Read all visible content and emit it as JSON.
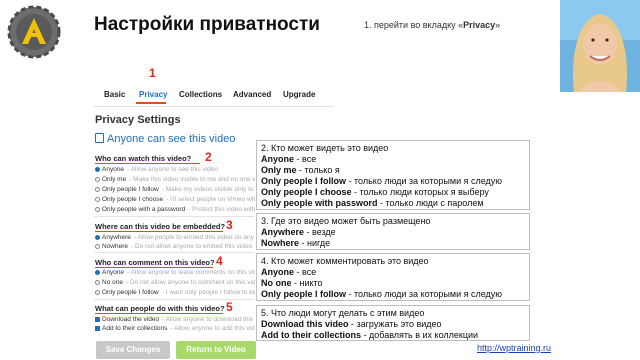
{
  "slide": {
    "title": "Настройки приватности",
    "step1_prefix": "1.  перейти во вкладку «",
    "step1_tab": "Privacy",
    "step1_suffix": "»",
    "link": "http://wptraining.ru"
  },
  "tabs": [
    {
      "label": "Basic",
      "active": false
    },
    {
      "label": "Privacy",
      "active": true
    },
    {
      "label": "Collections",
      "active": false
    },
    {
      "label": "Advanced",
      "active": false
    },
    {
      "label": "Upgrade",
      "active": false
    }
  ],
  "numbers": [
    "1",
    "2",
    "3",
    "4",
    "5"
  ],
  "settings": {
    "title": "Privacy Settings",
    "status": "Anyone can see this video",
    "sections": [
      {
        "question": "Who can watch this video?",
        "control": "radio",
        "options": [
          {
            "label": "Anyone",
            "desc": "- Allow anyone to see this video",
            "selected": true
          },
          {
            "label": "Only me",
            "desc": "- Make this video visible to me and no one else",
            "selected": false
          },
          {
            "label": "Only people I follow",
            "desc": "- Make my videos visible only to people I follow",
            "selected": false
          },
          {
            "label": "Only people I choose",
            "desc": "- I'll select people on Vimeo who can watch",
            "selected": false
          },
          {
            "label": "Only people with a password",
            "desc": "- Protect this video with a password",
            "selected": false
          }
        ]
      },
      {
        "question": "Where can this video be embedded?",
        "control": "radio",
        "options": [
          {
            "label": "Anywhere",
            "desc": "- Allow people to embed this video on any site",
            "selected": true
          },
          {
            "label": "Nowhere",
            "desc": "- Do not allow anyone to embed this video",
            "selected": false
          }
        ]
      },
      {
        "question": "Who can comment on this video?",
        "control": "radio",
        "options": [
          {
            "label": "Anyone",
            "desc": "- Allow anyone to leave comments on this video",
            "selected": true
          },
          {
            "label": "No one",
            "desc": "- Do not allow anyone to comment on this video",
            "selected": false
          },
          {
            "label": "Only people I follow",
            "desc": "- I want only people I follow to be able to comment",
            "selected": false
          }
        ]
      },
      {
        "question": "What can people do with this video?",
        "control": "checkbox",
        "options": [
          {
            "label": "Download the video",
            "desc": "- Allow anyone to download this video",
            "selected": true
          },
          {
            "label": "Add to their collections",
            "desc": "- Allow anyone to add this video to their collections",
            "selected": true
          }
        ]
      }
    ],
    "buttons": {
      "save": "Save Changes",
      "back": "Return to Video"
    }
  },
  "notes": [
    {
      "lines": [
        [
          {
            "t": "2. Кто может видеть это видео",
            "b": false
          }
        ],
        [
          {
            "t": "Anyone",
            "b": true
          },
          {
            "t": " - все",
            "b": false
          }
        ],
        [
          {
            "t": "Only me",
            "b": true
          },
          {
            "t": " - только я",
            "b": false
          }
        ],
        [
          {
            "t": "Only people I follow",
            "b": true
          },
          {
            "t": " - только люди за которыми я следую",
            "b": false
          }
        ],
        [
          {
            "t": "Only people I choose",
            "b": true
          },
          {
            "t": "  - только люди которых я выберу",
            "b": false
          }
        ],
        [
          {
            "t": "Only people  with password",
            "b": true
          },
          {
            "t": " - только люди с паролем",
            "b": false
          }
        ]
      ]
    },
    {
      "lines": [
        [
          {
            "t": "3. Где это видео может быть размещено",
            "b": false
          }
        ],
        [
          {
            "t": "Anywhere",
            "b": true
          },
          {
            "t": " - везде",
            "b": false
          }
        ],
        [
          {
            "t": "Nowhere",
            "b": true
          },
          {
            "t": " - нигде",
            "b": false
          }
        ]
      ]
    },
    {
      "lines": [
        [
          {
            "t": "4. Кто может комментировать это видео",
            "b": false
          }
        ],
        [
          {
            "t": "Anyone",
            "b": true
          },
          {
            "t": " - все",
            "b": false
          }
        ],
        [
          {
            "t": "No one",
            "b": true
          },
          {
            "t": " - никто",
            "b": false
          }
        ],
        [
          {
            "t": "Only people I follow",
            "b": true
          },
          {
            "t": " - только люди за которыми я следую",
            "b": false
          }
        ]
      ]
    },
    {
      "lines": [
        [
          {
            "t": "5. Что люди могут делать с этим видео",
            "b": false
          }
        ],
        [
          {
            "t": "Download this video",
            "b": true
          },
          {
            "t": " - загружать это видео",
            "b": false
          }
        ],
        [
          {
            "t": "Add to their collections",
            "b": true
          },
          {
            "t": " - добавлять в их коллекции",
            "b": false
          }
        ]
      ]
    }
  ],
  "colors": {
    "accent": "#1e6fbe",
    "marker": "#e0261f",
    "save": "#c8c8c8",
    "back": "#a8d86a"
  }
}
